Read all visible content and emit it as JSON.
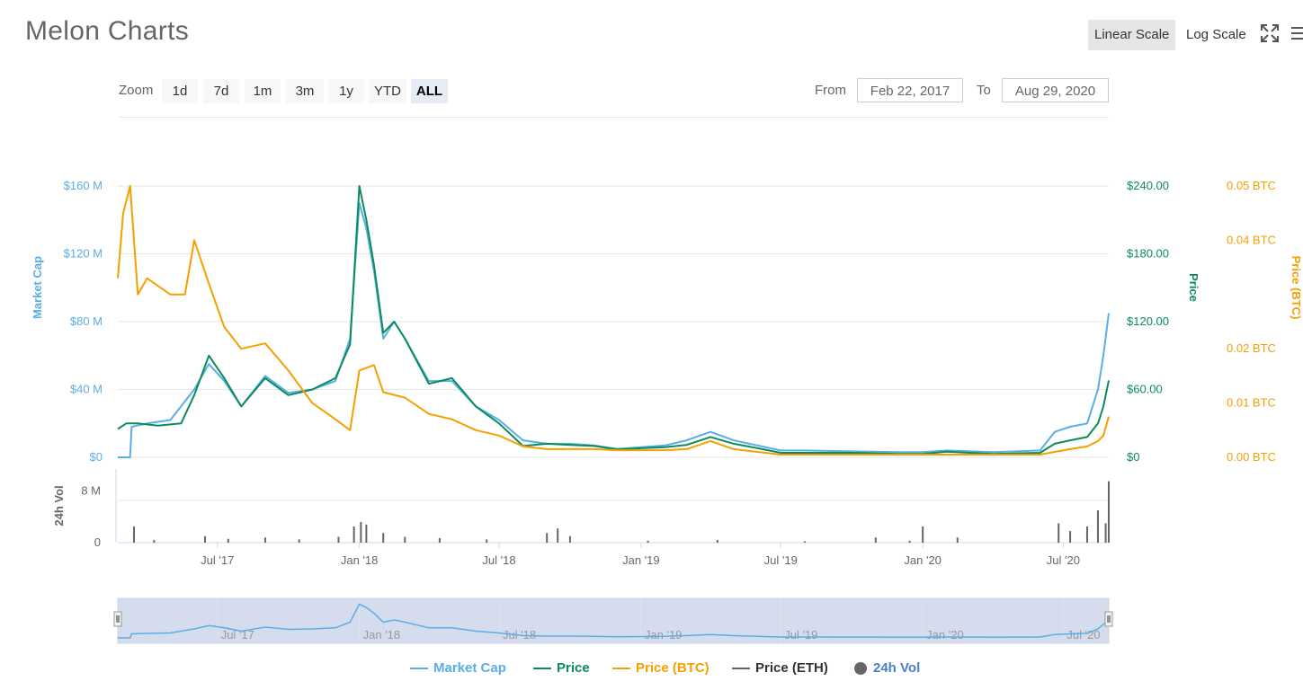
{
  "header": {
    "title": "Melon Charts",
    "linear_scale": "Linear Scale",
    "log_scale": "Log Scale"
  },
  "zoom": {
    "label": "Zoom",
    "buttons": [
      "1d",
      "7d",
      "1m",
      "3m",
      "1y",
      "YTD",
      "ALL"
    ],
    "active": "ALL"
  },
  "range": {
    "from_label": "From",
    "from_value": "Feb 22, 2017",
    "to_label": "To",
    "to_value": "Aug 29, 2020"
  },
  "colors": {
    "market_cap": "#5aaee6",
    "price": "#0b8c5a",
    "price_btc": "#f5a000",
    "price_eth": "#666666",
    "volume": "#666666",
    "navigator_fill": "#ccd6eb"
  },
  "chart_data": {
    "type": "line",
    "x_axis": {
      "type": "date",
      "range": [
        "2017-02-22",
        "2020-08-29"
      ],
      "tick_labels": [
        "Jul '17",
        "Jan '18",
        "Jul '18",
        "Jan '19",
        "Jul '19",
        "Jan '20",
        "Jul '20"
      ],
      "tick_dates": [
        "2017-07-01",
        "2018-01-01",
        "2018-07-01",
        "2019-01-01",
        "2019-07-01",
        "2020-01-01",
        "2020-07-01"
      ]
    },
    "y_axes": [
      {
        "id": "market_cap",
        "title": "Market Cap",
        "range": [
          0,
          160000000
        ],
        "ticks": [
          0,
          40000000,
          80000000,
          120000000,
          160000000
        ],
        "tick_labels": [
          "$0",
          "$40 M",
          "$80 M",
          "$120 M",
          "$160 M"
        ],
        "position": "left"
      },
      {
        "id": "price",
        "title": "Price",
        "range": [
          0,
          240
        ],
        "ticks": [
          0,
          60,
          120,
          180,
          240
        ],
        "tick_labels": [
          "$0",
          "$60.00",
          "$120.00",
          "$180.00",
          "$240.00"
        ],
        "position": "right"
      },
      {
        "id": "price_btc",
        "title": "Price (BTC)",
        "range": [
          0,
          0.05
        ],
        "ticks": [
          0,
          0.01,
          0.02,
          0.04,
          0.05
        ],
        "tick_labels": [
          "0.00 BTC",
          "0.01 BTC",
          "0.02 BTC",
          "0.04 BTC",
          "0.05 BTC"
        ],
        "position": "right"
      },
      {
        "id": "volume",
        "title": "24h Vol",
        "range": [
          0,
          10000000
        ],
        "ticks": [
          0,
          8000000
        ],
        "tick_labels": [
          "0",
          "8 M"
        ],
        "position": "left"
      }
    ],
    "grid": true,
    "legend_position": "bottom",
    "series": [
      {
        "name": "Market Cap",
        "axis": "market_cap",
        "points": [
          [
            "2017-02-22",
            0
          ],
          [
            "2017-03-10",
            0
          ],
          [
            "2017-03-12",
            18000000
          ],
          [
            "2017-04-01",
            20000000
          ],
          [
            "2017-05-01",
            22000000
          ],
          [
            "2017-06-01",
            40000000
          ],
          [
            "2017-06-20",
            55000000
          ],
          [
            "2017-07-10",
            45000000
          ],
          [
            "2017-08-01",
            30000000
          ],
          [
            "2017-09-01",
            48000000
          ],
          [
            "2017-10-01",
            38000000
          ],
          [
            "2017-11-01",
            40000000
          ],
          [
            "2017-12-01",
            45000000
          ],
          [
            "2017-12-20",
            70000000
          ],
          [
            "2018-01-01",
            150000000
          ],
          [
            "2018-01-10",
            135000000
          ],
          [
            "2018-01-20",
            110000000
          ],
          [
            "2018-02-01",
            70000000
          ],
          [
            "2018-02-15",
            80000000
          ],
          [
            "2018-03-01",
            70000000
          ],
          [
            "2018-04-01",
            45000000
          ],
          [
            "2018-05-01",
            45000000
          ],
          [
            "2018-06-01",
            30000000
          ],
          [
            "2018-07-01",
            22000000
          ],
          [
            "2018-08-01",
            10000000
          ],
          [
            "2018-09-01",
            8000000
          ],
          [
            "2018-10-01",
            8000000
          ],
          [
            "2018-11-01",
            7000000
          ],
          [
            "2018-12-01",
            5000000
          ],
          [
            "2019-01-01",
            6000000
          ],
          [
            "2019-02-01",
            7000000
          ],
          [
            "2019-03-01",
            10000000
          ],
          [
            "2019-04-01",
            15000000
          ],
          [
            "2019-05-01",
            10000000
          ],
          [
            "2019-06-01",
            7000000
          ],
          [
            "2019-07-01",
            4000000
          ],
          [
            "2019-08-01",
            4000000
          ],
          [
            "2019-10-01",
            3500000
          ],
          [
            "2019-12-01",
            3000000
          ],
          [
            "2020-01-01",
            3000000
          ],
          [
            "2020-02-01",
            4000000
          ],
          [
            "2020-04-01",
            3000000
          ],
          [
            "2020-06-01",
            4000000
          ],
          [
            "2020-06-20",
            15000000
          ],
          [
            "2020-07-10",
            18000000
          ],
          [
            "2020-08-01",
            20000000
          ],
          [
            "2020-08-15",
            40000000
          ],
          [
            "2020-08-22",
            60000000
          ],
          [
            "2020-08-29",
            85000000
          ]
        ]
      },
      {
        "name": "Price",
        "axis": "price",
        "points": [
          [
            "2017-02-22",
            25
          ],
          [
            "2017-03-05",
            30
          ],
          [
            "2017-03-20",
            30
          ],
          [
            "2017-04-15",
            28
          ],
          [
            "2017-05-15",
            30
          ],
          [
            "2017-06-01",
            55
          ],
          [
            "2017-06-20",
            90
          ],
          [
            "2017-07-10",
            70
          ],
          [
            "2017-08-01",
            45
          ],
          [
            "2017-09-01",
            70
          ],
          [
            "2017-10-01",
            55
          ],
          [
            "2017-11-01",
            60
          ],
          [
            "2017-12-01",
            70
          ],
          [
            "2017-12-20",
            100
          ],
          [
            "2018-01-01",
            240
          ],
          [
            "2018-01-10",
            210
          ],
          [
            "2018-01-20",
            170
          ],
          [
            "2018-02-01",
            110
          ],
          [
            "2018-02-15",
            120
          ],
          [
            "2018-03-01",
            105
          ],
          [
            "2018-04-01",
            65
          ],
          [
            "2018-05-01",
            70
          ],
          [
            "2018-06-01",
            45
          ],
          [
            "2018-07-01",
            30
          ],
          [
            "2018-08-01",
            10
          ],
          [
            "2018-09-01",
            12
          ],
          [
            "2018-10-01",
            11
          ],
          [
            "2018-11-01",
            10
          ],
          [
            "2018-12-01",
            7
          ],
          [
            "2019-01-01",
            8
          ],
          [
            "2019-02-01",
            9
          ],
          [
            "2019-03-01",
            11
          ],
          [
            "2019-04-01",
            18
          ],
          [
            "2019-05-01",
            12
          ],
          [
            "2019-06-01",
            8
          ],
          [
            "2019-07-01",
            4
          ],
          [
            "2019-08-01",
            4
          ],
          [
            "2019-10-01",
            4
          ],
          [
            "2019-12-01",
            3
          ],
          [
            "2020-01-01",
            3
          ],
          [
            "2020-02-01",
            5
          ],
          [
            "2020-04-01",
            3
          ],
          [
            "2020-06-01",
            4
          ],
          [
            "2020-06-20",
            12
          ],
          [
            "2020-07-10",
            15
          ],
          [
            "2020-08-01",
            18
          ],
          [
            "2020-08-15",
            30
          ],
          [
            "2020-08-22",
            45
          ],
          [
            "2020-08-29",
            68
          ]
        ]
      },
      {
        "name": "Price (BTC)",
        "axis": "price_btc",
        "points": [
          [
            "2017-02-22",
            0.033
          ],
          [
            "2017-03-01",
            0.045
          ],
          [
            "2017-03-10",
            0.05
          ],
          [
            "2017-03-20",
            0.03
          ],
          [
            "2017-04-01",
            0.033
          ],
          [
            "2017-05-01",
            0.03
          ],
          [
            "2017-05-20",
            0.03
          ],
          [
            "2017-06-01",
            0.04
          ],
          [
            "2017-06-20",
            0.032
          ],
          [
            "2017-07-10",
            0.024
          ],
          [
            "2017-08-01",
            0.02
          ],
          [
            "2017-09-01",
            0.021
          ],
          [
            "2017-10-01",
            0.016
          ],
          [
            "2017-11-01",
            0.01
          ],
          [
            "2017-12-01",
            0.007
          ],
          [
            "2017-12-20",
            0.005
          ],
          [
            "2018-01-01",
            0.016
          ],
          [
            "2018-01-20",
            0.017
          ],
          [
            "2018-02-01",
            0.012
          ],
          [
            "2018-03-01",
            0.011
          ],
          [
            "2018-04-01",
            0.008
          ],
          [
            "2018-05-01",
            0.007
          ],
          [
            "2018-06-01",
            0.005
          ],
          [
            "2018-07-01",
            0.004
          ],
          [
            "2018-08-01",
            0.002
          ],
          [
            "2018-09-01",
            0.0015
          ],
          [
            "2018-10-01",
            0.0015
          ],
          [
            "2018-11-01",
            0.0015
          ],
          [
            "2018-12-01",
            0.0013
          ],
          [
            "2019-01-01",
            0.0013
          ],
          [
            "2019-02-01",
            0.0013
          ],
          [
            "2019-03-01",
            0.0015
          ],
          [
            "2019-04-01",
            0.003
          ],
          [
            "2019-05-01",
            0.0015
          ],
          [
            "2019-06-01",
            0.001
          ],
          [
            "2019-07-01",
            0.0005
          ],
          [
            "2019-08-01",
            0.0005
          ],
          [
            "2019-10-01",
            0.0005
          ],
          [
            "2019-12-01",
            0.0005
          ],
          [
            "2020-01-01",
            0.0005
          ],
          [
            "2020-02-01",
            0.0005
          ],
          [
            "2020-04-01",
            0.0005
          ],
          [
            "2020-06-01",
            0.0005
          ],
          [
            "2020-06-20",
            0.001
          ],
          [
            "2020-07-10",
            0.0015
          ],
          [
            "2020-08-01",
            0.002
          ],
          [
            "2020-08-15",
            0.003
          ],
          [
            "2020-08-22",
            0.004
          ],
          [
            "2020-08-29",
            0.0075
          ]
        ]
      },
      {
        "name": "Price (ETH)",
        "axis": "price"
      },
      {
        "name": "24h Vol",
        "axis": "volume",
        "bars": [
          [
            "2017-03-15",
            2500000
          ],
          [
            "2017-04-10",
            400000
          ],
          [
            "2017-06-15",
            1000000
          ],
          [
            "2017-07-15",
            600000
          ],
          [
            "2017-09-01",
            800000
          ],
          [
            "2017-10-15",
            500000
          ],
          [
            "2017-12-05",
            900000
          ],
          [
            "2017-12-25",
            2500000
          ],
          [
            "2018-01-03",
            3200000
          ],
          [
            "2018-01-10",
            2800000
          ],
          [
            "2018-02-01",
            1500000
          ],
          [
            "2018-03-01",
            900000
          ],
          [
            "2018-04-15",
            700000
          ],
          [
            "2018-06-15",
            500000
          ],
          [
            "2018-09-01",
            1500000
          ],
          [
            "2018-09-15",
            2200000
          ],
          [
            "2018-10-01",
            1000000
          ],
          [
            "2019-01-10",
            300000
          ],
          [
            "2019-04-10",
            400000
          ],
          [
            "2019-08-01",
            200000
          ],
          [
            "2019-11-01",
            800000
          ],
          [
            "2019-12-15",
            300000
          ],
          [
            "2020-01-01",
            2500000
          ],
          [
            "2020-02-15",
            800000
          ],
          [
            "2020-06-25",
            3000000
          ],
          [
            "2020-07-10",
            1800000
          ],
          [
            "2020-08-01",
            2500000
          ],
          [
            "2020-08-15",
            5000000
          ],
          [
            "2020-08-25",
            3000000
          ],
          [
            "2020-08-29",
            9500000
          ]
        ]
      }
    ]
  },
  "navigator": {
    "tick_labels": [
      "Jul '17",
      "Jan '18",
      "Jul '18",
      "Jan '19",
      "Jul '19",
      "Jan '20",
      "Jul '20"
    ]
  },
  "legend": [
    {
      "label": "Market Cap",
      "color": "#5aaee6",
      "symbol": "line"
    },
    {
      "label": "Price",
      "color": "#0b8c5a",
      "symbol": "line"
    },
    {
      "label": "Price (BTC)",
      "color": "#f5a000",
      "symbol": "line"
    },
    {
      "label": "Price (ETH)",
      "color": "#666666",
      "symbol": "line"
    },
    {
      "label": "24h Vol",
      "color": "#666666",
      "symbol": "circle"
    }
  ]
}
